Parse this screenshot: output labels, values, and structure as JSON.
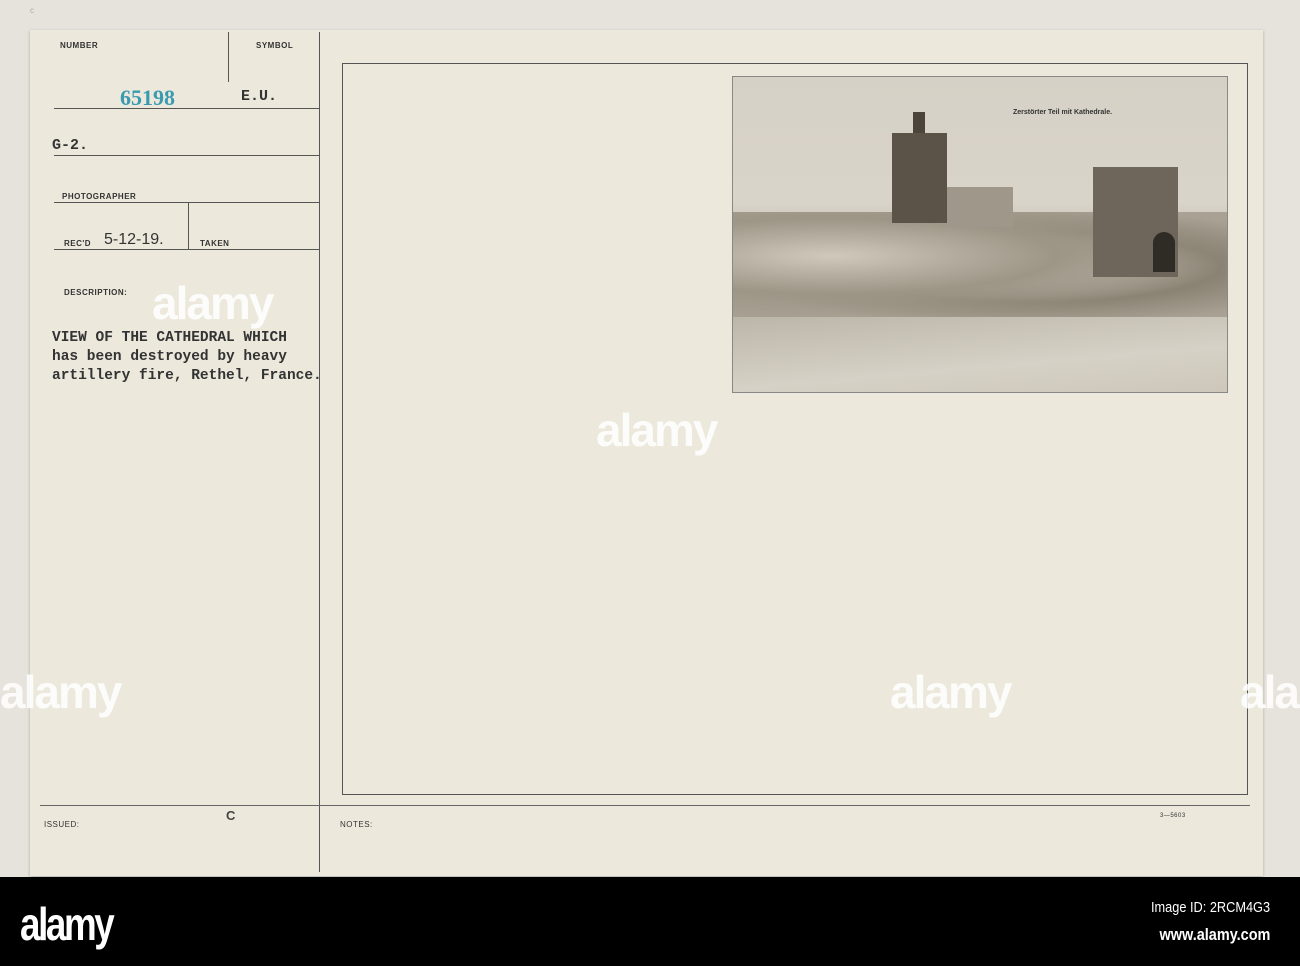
{
  "card": {
    "number_label": "NUMBER",
    "number": "65198",
    "symbol_label": "SYMBOL",
    "symbol": "E.U.",
    "unit": "G-2.",
    "photographer_label": "PHOTOGRAPHER",
    "recd_label": "REC'D",
    "recd": "5-12-19.",
    "taken_label": "TAKEN",
    "description_label": "DESCRIPTION:",
    "description": [
      "VIEW OF THE CATHEDRAL WHICH",
      "has been destroyed by heavy",
      "artillery fire, Rethel, France."
    ],
    "issued_label": "ISSUED:",
    "issued_mark": "C",
    "notes_label": "NOTES:",
    "form_number": "3—5603",
    "corner_mark": "c"
  },
  "photo": {
    "caption": "Zerstörter Teil mit Kathedrale."
  },
  "watermark": {
    "text": "alamy",
    "glyph": "a"
  },
  "footer": {
    "logo": "alamy",
    "image_id": "Image ID: 2RCM4G3",
    "url": "www.alamy.com"
  },
  "colors": {
    "number_ink": "#3a9bb0",
    "paper": "#ece8dc"
  }
}
